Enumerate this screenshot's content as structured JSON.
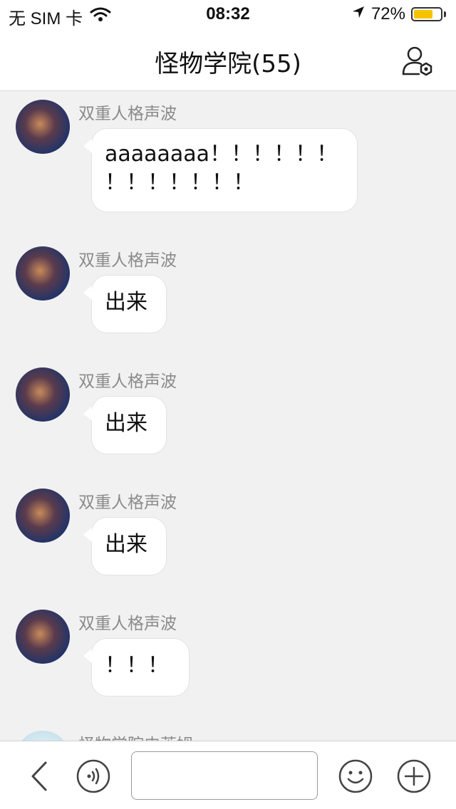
{
  "status_bar": {
    "carrier": "无 SIM 卡",
    "time": "08:32",
    "battery_percent": "72%",
    "battery_level": 0.72
  },
  "header": {
    "title": "怪物学院(55)"
  },
  "messages": [
    {
      "sender": "双重人格声波",
      "lines": [
        "aaaaaaaa！！！！！！",
        "！！！！！！！"
      ]
    },
    {
      "sender": "双重人格声波",
      "lines": [
        "出来"
      ]
    },
    {
      "sender": "双重人格声波",
      "lines": [
        "出来"
      ]
    },
    {
      "sender": "双重人格声波",
      "lines": [
        "出来"
      ]
    },
    {
      "sender": "双重人格声波",
      "lines": [
        "！！！"
      ]
    },
    {
      "sender": "怪物学院史莱姆",
      "lines": []
    }
  ],
  "toolbar": {
    "input_value": "",
    "icons": [
      "back-icon",
      "voice-icon",
      "emoji-icon",
      "plus-icon"
    ]
  },
  "colors": {
    "background": "#f1f1f1",
    "bubble": "#ffffff",
    "battery": "#f5c400"
  }
}
